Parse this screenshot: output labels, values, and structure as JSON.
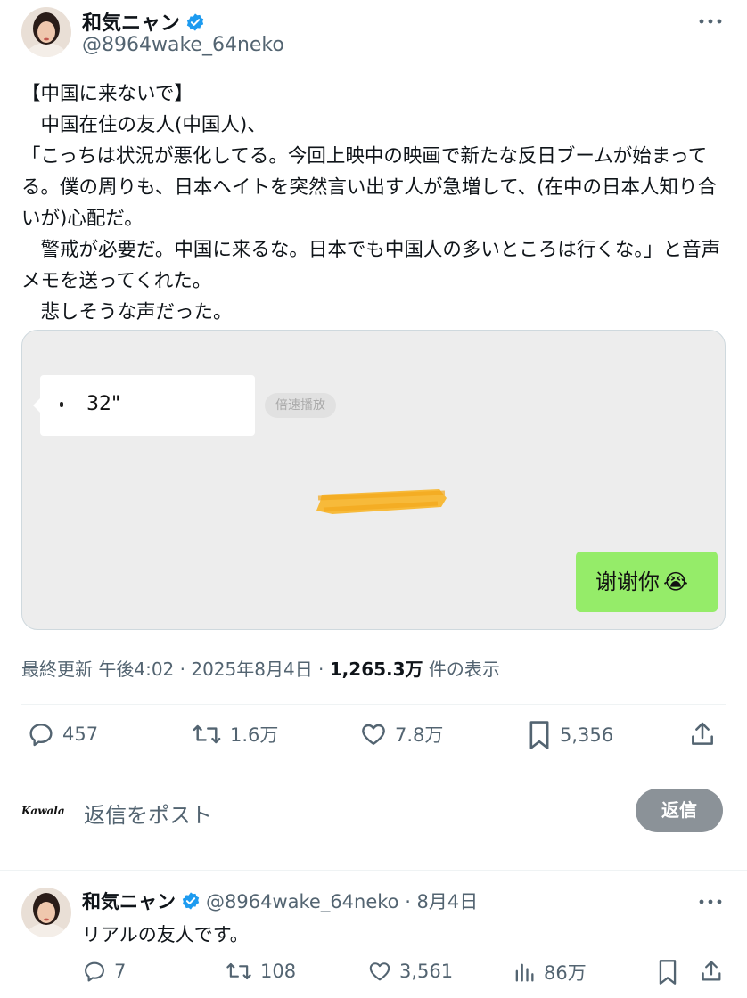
{
  "main_tweet": {
    "display_name": "和気ニャン",
    "handle": "@8964wake_64neko",
    "body": "【中国に来ないで】\n　中国在住の友人(中国人)、\n「こっちは状況が悪化してる。今回上映中の映画で新たな反日ブームが始まってる。僕の周りも、日本ヘイトを突然言い出す人が急増して、(在中の日本人知り合いが)心配だ。\n　警戒が必要だ。中国に来るな。日本でも中国人の多いところは行くな。」と音声メモを送ってくれた。\n　悲しそうな声だった。",
    "media": {
      "voice_duration": "32\"",
      "speed_chip": "倍速播放",
      "outgoing_message": "谢谢你",
      "outgoing_emoji": "😭"
    },
    "meta": {
      "prefix": "最終更新 午後4:02 · 2025年8月4日 · ",
      "views": "1,265.3万",
      "suffix": " 件の表示"
    },
    "actions": {
      "replies": "457",
      "reposts": "1.6万",
      "likes": "7.8万",
      "bookmarks": "5,356"
    }
  },
  "reply_composer": {
    "avatar_text": "Kawala",
    "placeholder": "返信をポスト",
    "button_label": "返信"
  },
  "reply_tweet": {
    "display_name": "和気ニャン",
    "handle_date": "@8964wake_64neko · 8月4日",
    "body": "リアルの友人です。",
    "actions": {
      "replies": "7",
      "reposts": "108",
      "likes": "3,561",
      "views": "86万"
    }
  },
  "colors": {
    "verified": "#1d9bf0",
    "secondary_text": "#536471",
    "wechat_green": "#95ec69",
    "reply_button": "#8b9298"
  }
}
